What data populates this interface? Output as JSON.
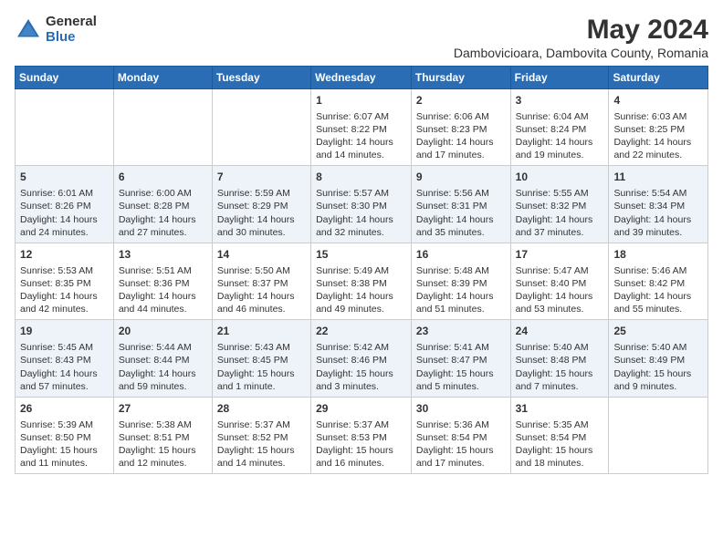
{
  "header": {
    "logo_general": "General",
    "logo_blue": "Blue",
    "main_title": "May 2024",
    "subtitle": "Dambovicioara, Dambovita County, Romania"
  },
  "weekdays": [
    "Sunday",
    "Monday",
    "Tuesday",
    "Wednesday",
    "Thursday",
    "Friday",
    "Saturday"
  ],
  "weeks": [
    [
      {
        "day": "",
        "content": ""
      },
      {
        "day": "",
        "content": ""
      },
      {
        "day": "",
        "content": ""
      },
      {
        "day": "1",
        "content": "Sunrise: 6:07 AM\nSunset: 8:22 PM\nDaylight: 14 hours and 14 minutes."
      },
      {
        "day": "2",
        "content": "Sunrise: 6:06 AM\nSunset: 8:23 PM\nDaylight: 14 hours and 17 minutes."
      },
      {
        "day": "3",
        "content": "Sunrise: 6:04 AM\nSunset: 8:24 PM\nDaylight: 14 hours and 19 minutes."
      },
      {
        "day": "4",
        "content": "Sunrise: 6:03 AM\nSunset: 8:25 PM\nDaylight: 14 hours and 22 minutes."
      }
    ],
    [
      {
        "day": "5",
        "content": "Sunrise: 6:01 AM\nSunset: 8:26 PM\nDaylight: 14 hours and 24 minutes."
      },
      {
        "day": "6",
        "content": "Sunrise: 6:00 AM\nSunset: 8:28 PM\nDaylight: 14 hours and 27 minutes."
      },
      {
        "day": "7",
        "content": "Sunrise: 5:59 AM\nSunset: 8:29 PM\nDaylight: 14 hours and 30 minutes."
      },
      {
        "day": "8",
        "content": "Sunrise: 5:57 AM\nSunset: 8:30 PM\nDaylight: 14 hours and 32 minutes."
      },
      {
        "day": "9",
        "content": "Sunrise: 5:56 AM\nSunset: 8:31 PM\nDaylight: 14 hours and 35 minutes."
      },
      {
        "day": "10",
        "content": "Sunrise: 5:55 AM\nSunset: 8:32 PM\nDaylight: 14 hours and 37 minutes."
      },
      {
        "day": "11",
        "content": "Sunrise: 5:54 AM\nSunset: 8:34 PM\nDaylight: 14 hours and 39 minutes."
      }
    ],
    [
      {
        "day": "12",
        "content": "Sunrise: 5:53 AM\nSunset: 8:35 PM\nDaylight: 14 hours and 42 minutes."
      },
      {
        "day": "13",
        "content": "Sunrise: 5:51 AM\nSunset: 8:36 PM\nDaylight: 14 hours and 44 minutes."
      },
      {
        "day": "14",
        "content": "Sunrise: 5:50 AM\nSunset: 8:37 PM\nDaylight: 14 hours and 46 minutes."
      },
      {
        "day": "15",
        "content": "Sunrise: 5:49 AM\nSunset: 8:38 PM\nDaylight: 14 hours and 49 minutes."
      },
      {
        "day": "16",
        "content": "Sunrise: 5:48 AM\nSunset: 8:39 PM\nDaylight: 14 hours and 51 minutes."
      },
      {
        "day": "17",
        "content": "Sunrise: 5:47 AM\nSunset: 8:40 PM\nDaylight: 14 hours and 53 minutes."
      },
      {
        "day": "18",
        "content": "Sunrise: 5:46 AM\nSunset: 8:42 PM\nDaylight: 14 hours and 55 minutes."
      }
    ],
    [
      {
        "day": "19",
        "content": "Sunrise: 5:45 AM\nSunset: 8:43 PM\nDaylight: 14 hours and 57 minutes."
      },
      {
        "day": "20",
        "content": "Sunrise: 5:44 AM\nSunset: 8:44 PM\nDaylight: 14 hours and 59 minutes."
      },
      {
        "day": "21",
        "content": "Sunrise: 5:43 AM\nSunset: 8:45 PM\nDaylight: 15 hours and 1 minute."
      },
      {
        "day": "22",
        "content": "Sunrise: 5:42 AM\nSunset: 8:46 PM\nDaylight: 15 hours and 3 minutes."
      },
      {
        "day": "23",
        "content": "Sunrise: 5:41 AM\nSunset: 8:47 PM\nDaylight: 15 hours and 5 minutes."
      },
      {
        "day": "24",
        "content": "Sunrise: 5:40 AM\nSunset: 8:48 PM\nDaylight: 15 hours and 7 minutes."
      },
      {
        "day": "25",
        "content": "Sunrise: 5:40 AM\nSunset: 8:49 PM\nDaylight: 15 hours and 9 minutes."
      }
    ],
    [
      {
        "day": "26",
        "content": "Sunrise: 5:39 AM\nSunset: 8:50 PM\nDaylight: 15 hours and 11 minutes."
      },
      {
        "day": "27",
        "content": "Sunrise: 5:38 AM\nSunset: 8:51 PM\nDaylight: 15 hours and 12 minutes."
      },
      {
        "day": "28",
        "content": "Sunrise: 5:37 AM\nSunset: 8:52 PM\nDaylight: 15 hours and 14 minutes."
      },
      {
        "day": "29",
        "content": "Sunrise: 5:37 AM\nSunset: 8:53 PM\nDaylight: 15 hours and 16 minutes."
      },
      {
        "day": "30",
        "content": "Sunrise: 5:36 AM\nSunset: 8:54 PM\nDaylight: 15 hours and 17 minutes."
      },
      {
        "day": "31",
        "content": "Sunrise: 5:35 AM\nSunset: 8:54 PM\nDaylight: 15 hours and 18 minutes."
      },
      {
        "day": "",
        "content": ""
      }
    ]
  ]
}
